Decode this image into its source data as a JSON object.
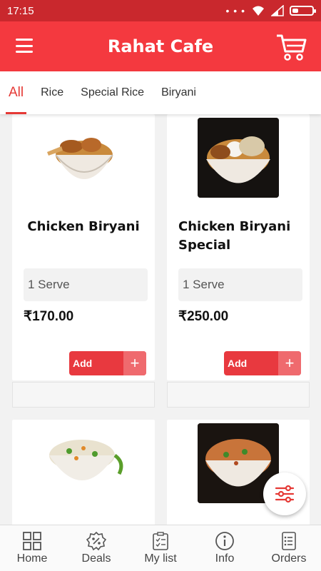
{
  "status_bar": {
    "time": "17:15",
    "dots": "• • •"
  },
  "app_bar": {
    "title": "Rahat Cafe"
  },
  "tabs": [
    {
      "label": "All",
      "active": true
    },
    {
      "label": "Rice",
      "active": false
    },
    {
      "label": "Special Rice",
      "active": false
    },
    {
      "label": "Biryani",
      "active": false
    }
  ],
  "products": [
    {
      "name": "Chicken Biryani",
      "serve": "1 Serve",
      "price": "₹170.00",
      "add_label": "Add",
      "add_icon": "+"
    },
    {
      "name": "Chicken Biryani Special",
      "serve": "1 Serve",
      "price": "₹250.00",
      "add_label": "Add",
      "add_icon": "+"
    },
    {
      "name": "",
      "serve": "",
      "price": "",
      "add_label": "",
      "add_icon": ""
    },
    {
      "name": "",
      "serve": "",
      "price": "",
      "add_label": "",
      "add_icon": ""
    }
  ],
  "bottom_nav": [
    {
      "label": "Home",
      "icon": "grid-icon"
    },
    {
      "label": "Deals",
      "icon": "discount-icon"
    },
    {
      "label": "My list",
      "icon": "checklist-icon"
    },
    {
      "label": "Info",
      "icon": "info-icon"
    },
    {
      "label": "Orders",
      "icon": "orders-icon"
    }
  ],
  "colors": {
    "primary": "#f4393f",
    "status_bar": "#c9282d",
    "add_button": "#e8393f",
    "tab_active": "#e53935"
  }
}
